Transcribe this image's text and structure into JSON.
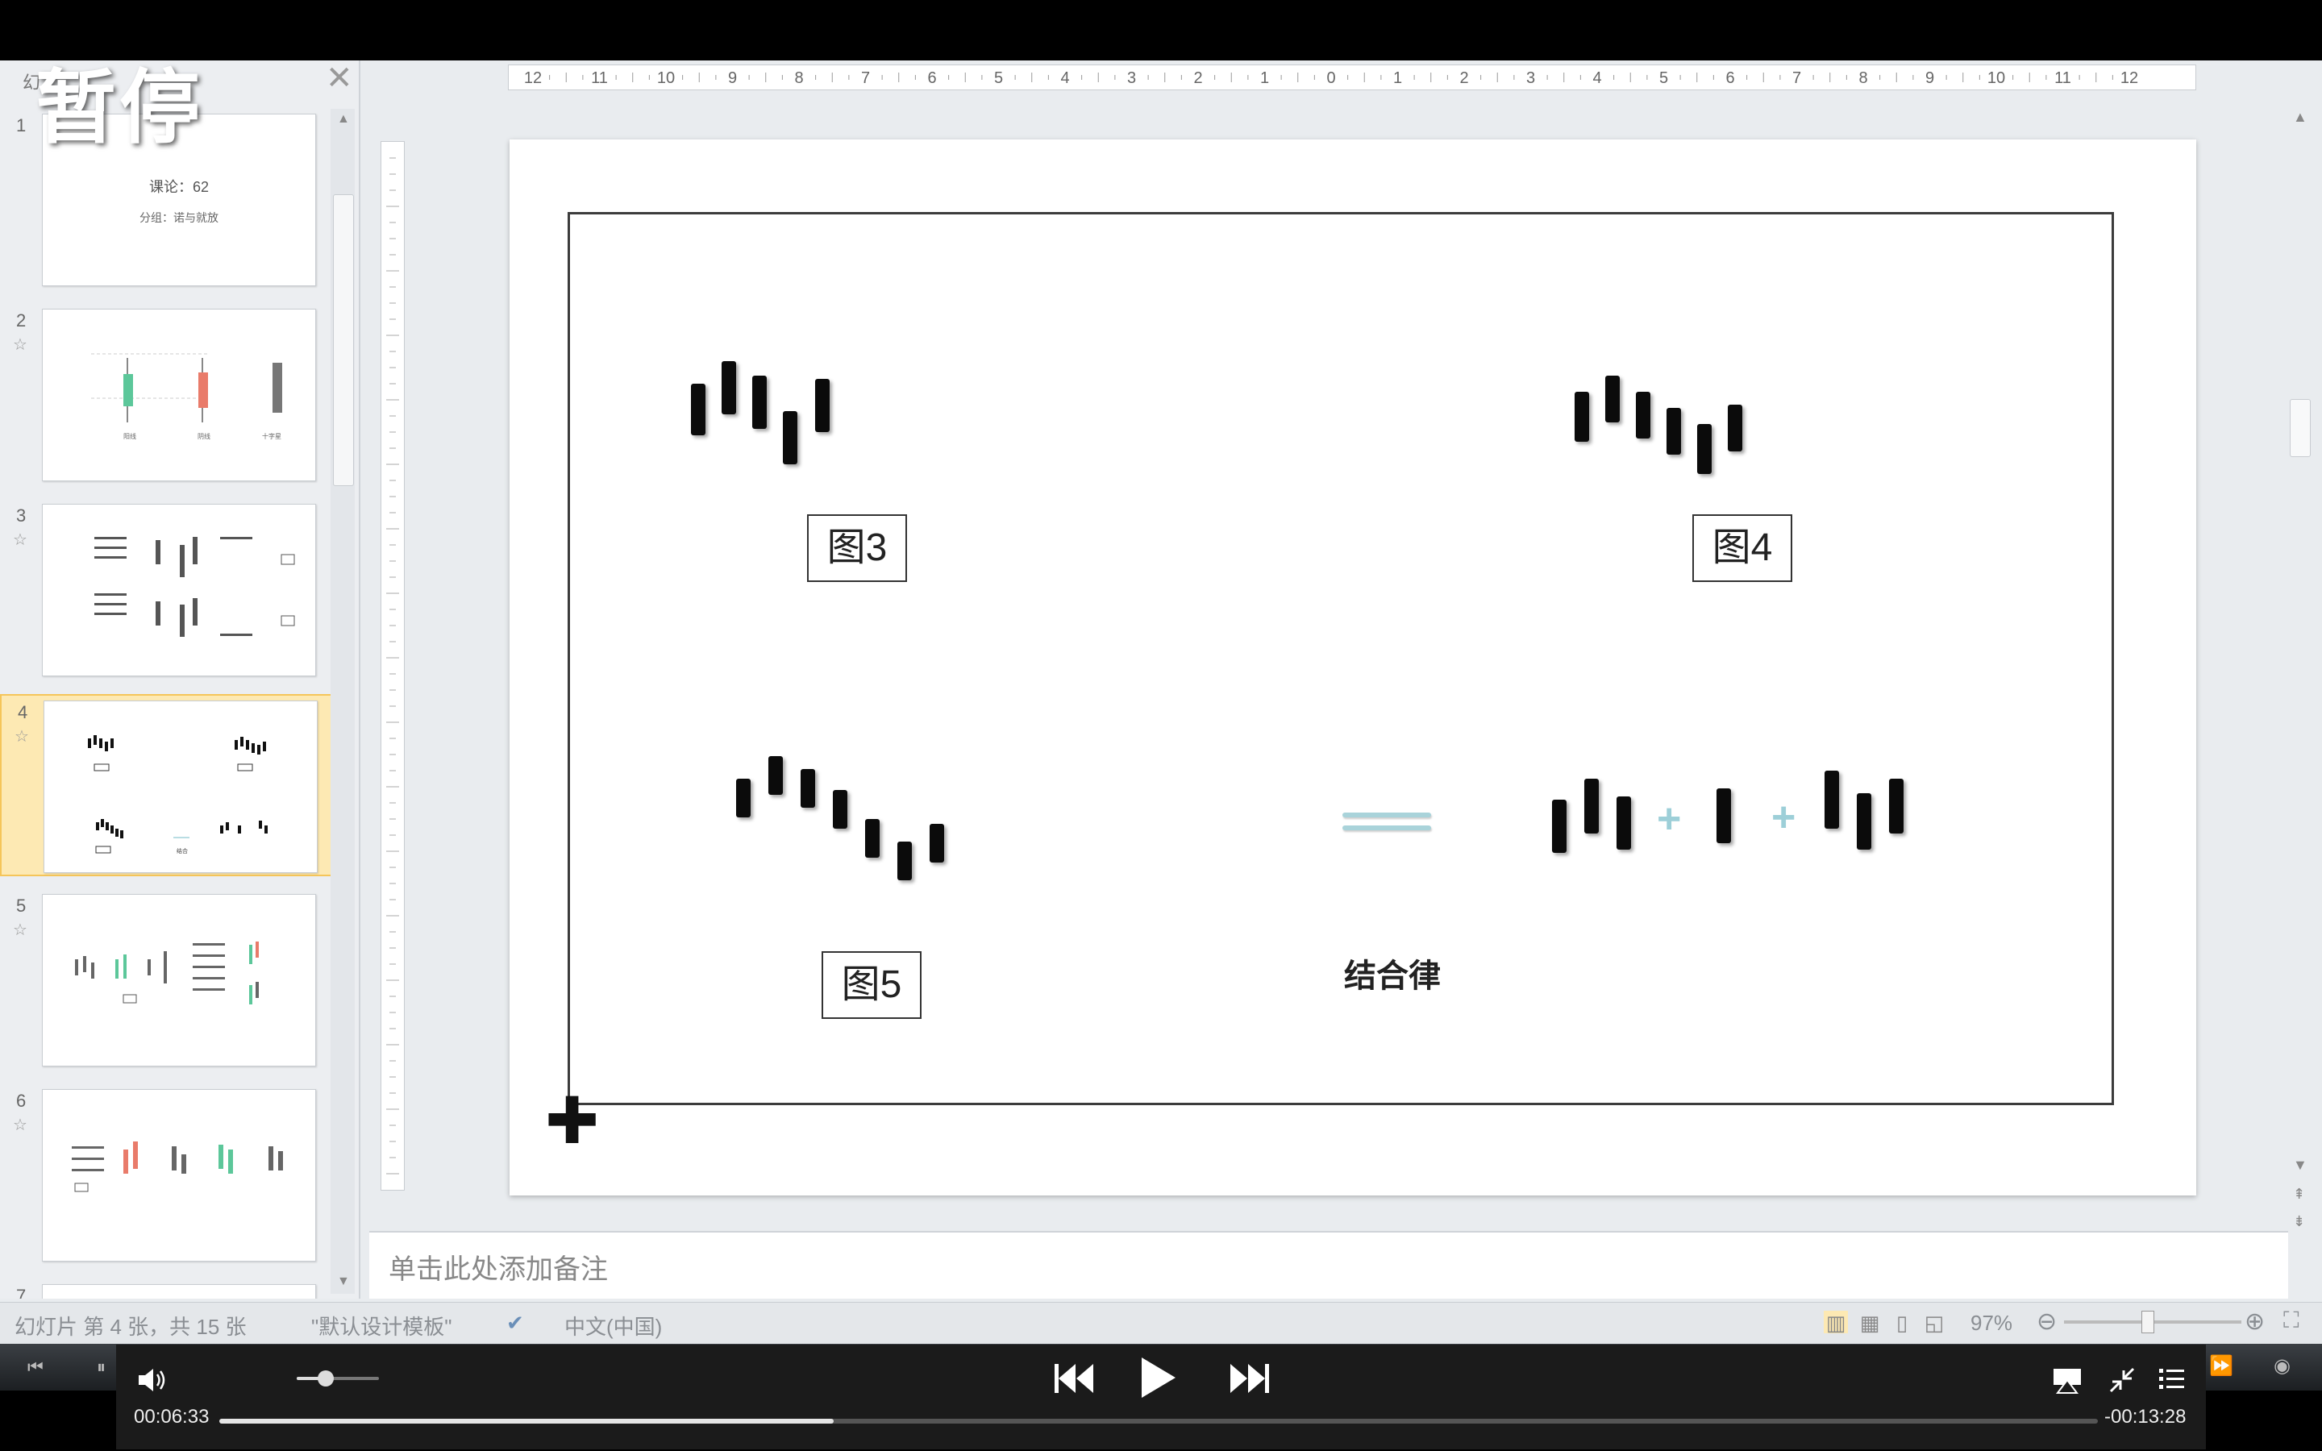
{
  "overlay": {
    "pause_label": "暂停"
  },
  "thumbnail_pane": {
    "tab_label": "幻",
    "close_glyph": "✕",
    "slides": [
      {
        "number": "1",
        "line1": "课论：62",
        "line2": "分组：诺与就放"
      },
      {
        "number": "2"
      },
      {
        "number": "3"
      },
      {
        "number": "4",
        "active": true
      },
      {
        "number": "5"
      },
      {
        "number": "6"
      },
      {
        "number": "7"
      }
    ]
  },
  "ruler": {
    "labels": [
      "12",
      "11",
      "10",
      "9",
      "8",
      "7",
      "6",
      "5",
      "4",
      "3",
      "2",
      "1",
      "0",
      "1",
      "2",
      "3",
      "4",
      "5",
      "6",
      "7",
      "8",
      "9",
      "10",
      "11",
      "12"
    ]
  },
  "slide": {
    "label_fig3": "图3",
    "label_fig4": "图4",
    "label_fig5": "图5",
    "caption": "结合律",
    "plus1": "+",
    "plus2": "+"
  },
  "notes": {
    "placeholder": "单击此处添加备注"
  },
  "statusbar": {
    "slide_position": "幻灯片 第 4 张，共 15 张",
    "template": "\"默认设计模板\"",
    "language": "中文(中国)",
    "zoom": "97%"
  },
  "player": {
    "current_time": "00:06:33",
    "remaining_time": "-00:13:28",
    "progress_fraction": 0.327,
    "volume_fraction": 0.35,
    "icons": [
      "volume-icon",
      "previous-track-icon",
      "play-icon",
      "next-track-icon",
      "airplay-icon",
      "exit-fullscreen-icon",
      "playlist-icon"
    ]
  }
}
